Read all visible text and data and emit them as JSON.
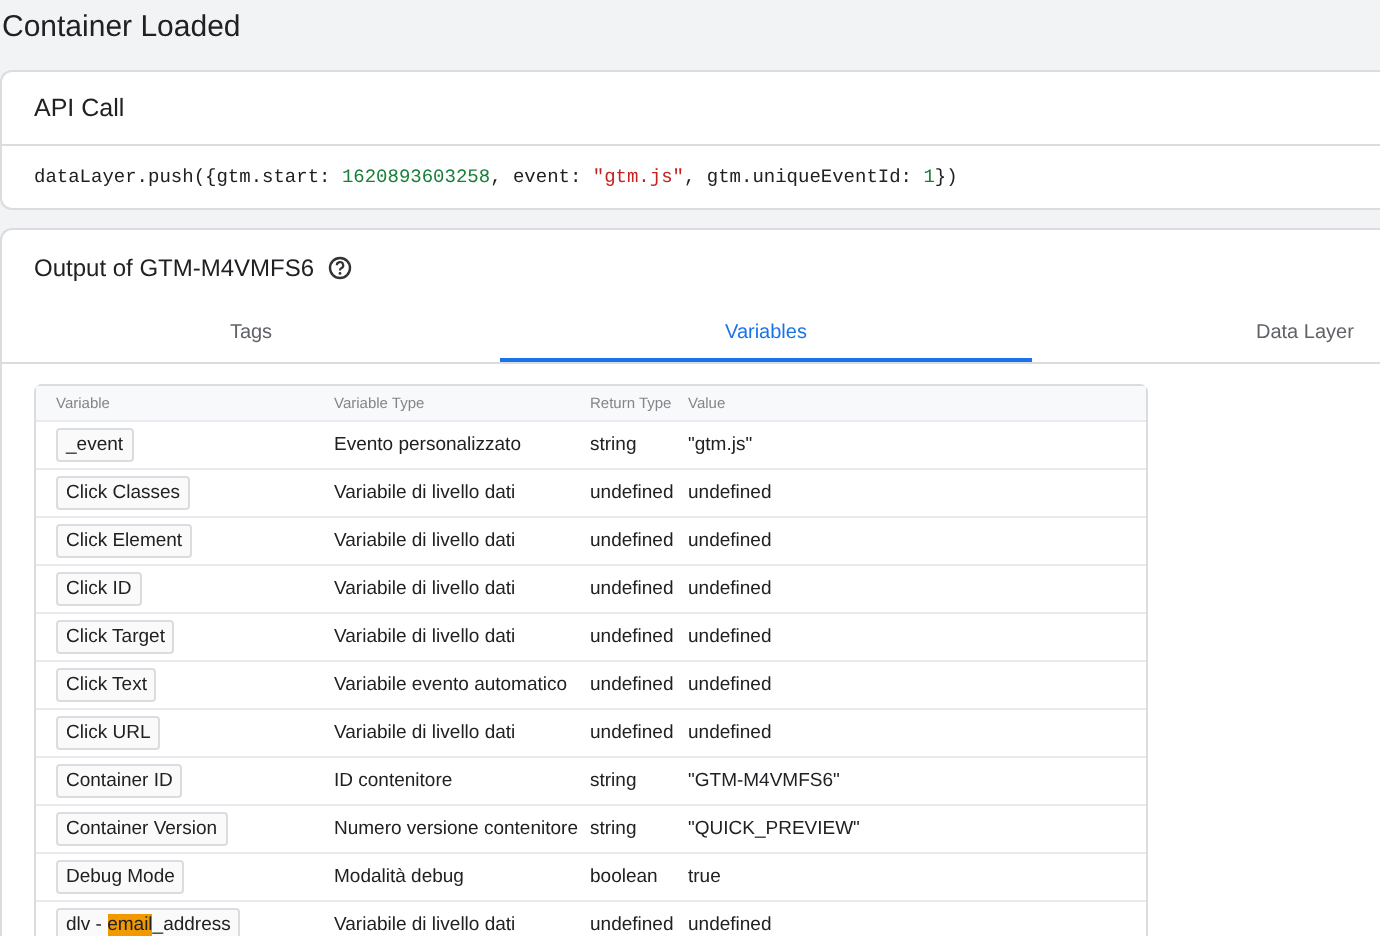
{
  "page_title": "Container Loaded",
  "api_call": {
    "title": "API Call",
    "code": [
      {
        "kind": "plain",
        "text": "dataLayer.push({gtm.start: "
      },
      {
        "kind": "number",
        "text": "1620893603258"
      },
      {
        "kind": "plain",
        "text": ", event: "
      },
      {
        "kind": "string",
        "text": "\"gtm.js\""
      },
      {
        "kind": "plain",
        "text": ", gtm.uniqueEventId: "
      },
      {
        "kind": "number",
        "text": "1"
      },
      {
        "kind": "plain",
        "text": "})"
      }
    ]
  },
  "output": {
    "title": "Output of GTM-M4VMFS6",
    "tabs": [
      {
        "label": "Tags",
        "selected": false
      },
      {
        "label": "Variables",
        "selected": true
      },
      {
        "label": "Data Layer",
        "selected": false
      }
    ],
    "table": {
      "columns": [
        "Variable",
        "Variable Type",
        "Return Type",
        "Value"
      ],
      "rows": [
        {
          "name_parts": [
            {
              "text": "_event",
              "highlighted": false
            }
          ],
          "type": "Evento personalizzato",
          "return_type": "string",
          "value": "\"gtm.js\""
        },
        {
          "name_parts": [
            {
              "text": "Click Classes",
              "highlighted": false
            }
          ],
          "type": "Variabile di livello dati",
          "return_type": "undefined",
          "value": "undefined"
        },
        {
          "name_parts": [
            {
              "text": "Click Element",
              "highlighted": false
            }
          ],
          "type": "Variabile di livello dati",
          "return_type": "undefined",
          "value": "undefined"
        },
        {
          "name_parts": [
            {
              "text": "Click ID",
              "highlighted": false
            }
          ],
          "type": "Variabile di livello dati",
          "return_type": "undefined",
          "value": "undefined"
        },
        {
          "name_parts": [
            {
              "text": "Click Target",
              "highlighted": false
            }
          ],
          "type": "Variabile di livello dati",
          "return_type": "undefined",
          "value": "undefined"
        },
        {
          "name_parts": [
            {
              "text": "Click Text",
              "highlighted": false
            }
          ],
          "type": "Variabile evento automatico",
          "return_type": "undefined",
          "value": "undefined"
        },
        {
          "name_parts": [
            {
              "text": "Click URL",
              "highlighted": false
            }
          ],
          "type": "Variabile di livello dati",
          "return_type": "undefined",
          "value": "undefined"
        },
        {
          "name_parts": [
            {
              "text": "Container ID",
              "highlighted": false
            }
          ],
          "type": "ID contenitore",
          "return_type": "string",
          "value": "\"GTM-M4VMFS6\""
        },
        {
          "name_parts": [
            {
              "text": "Container Version",
              "highlighted": false
            }
          ],
          "type": "Numero versione contenitore",
          "return_type": "string",
          "value": "\"QUICK_PREVIEW\""
        },
        {
          "name_parts": [
            {
              "text": "Debug Mode",
              "highlighted": false
            }
          ],
          "type": "Modalità debug",
          "return_type": "boolean",
          "value": "true"
        },
        {
          "name_parts": [
            {
              "text": "dlv - ",
              "highlighted": false
            },
            {
              "text": "email",
              "highlighted": true
            },
            {
              "text": "_address",
              "highlighted": false
            }
          ],
          "type": "Variabile di livello dati",
          "return_type": "undefined",
          "value": "undefined"
        }
      ]
    }
  }
}
